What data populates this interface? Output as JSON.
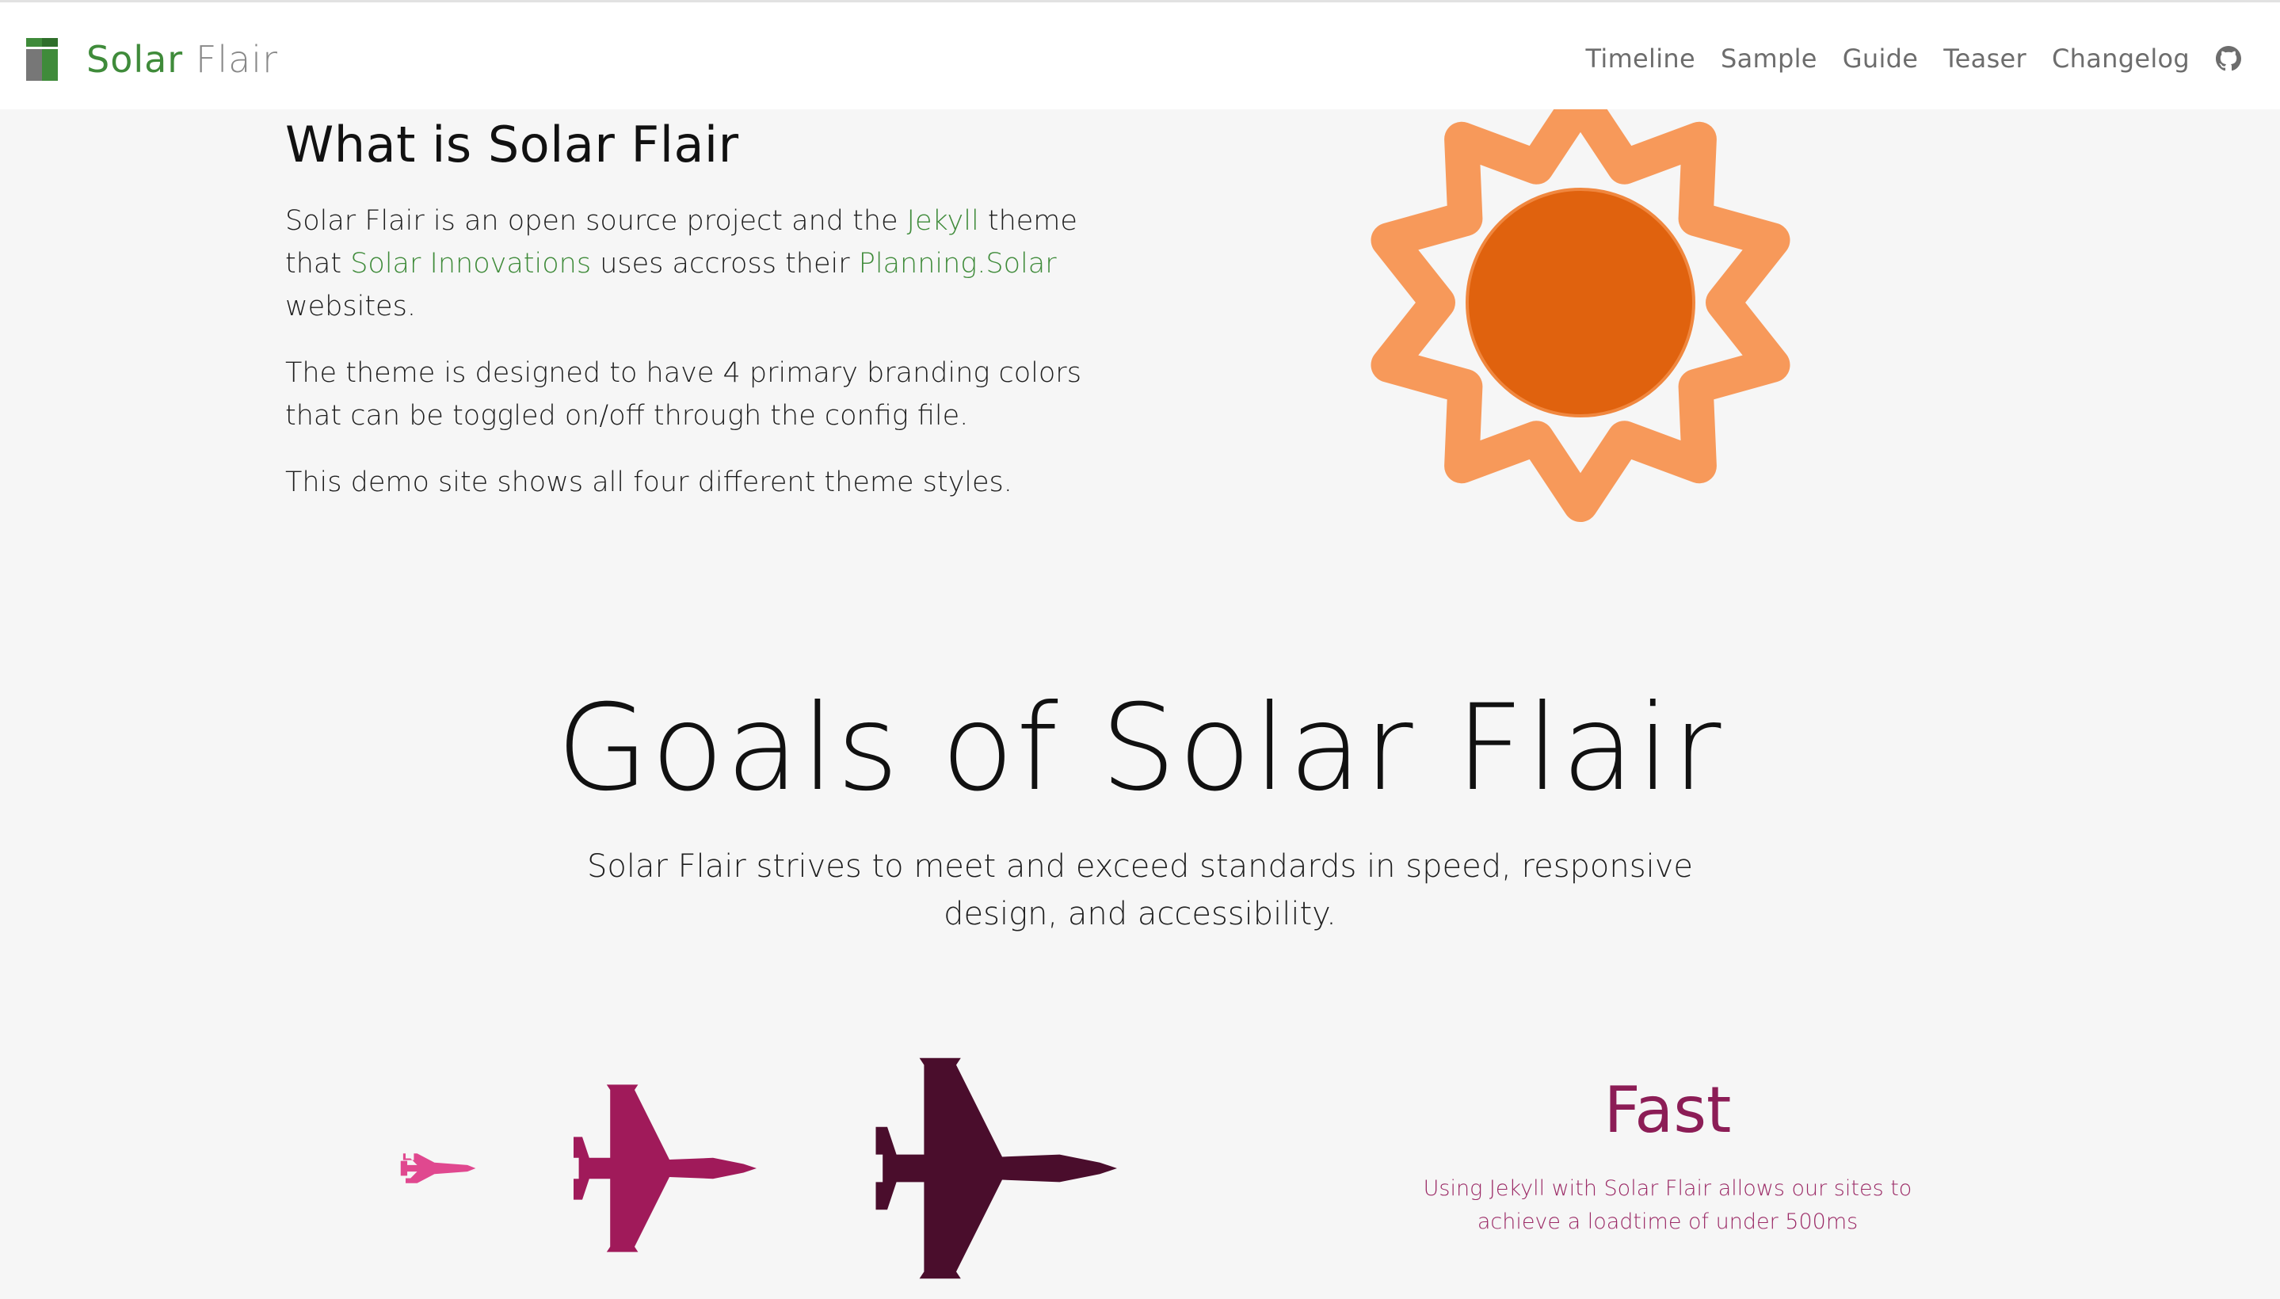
{
  "nav": {
    "brand": {
      "solar": "Solar",
      "flair": "Flair"
    },
    "links": [
      "Timeline",
      "Sample",
      "Guide",
      "Teaser",
      "Changelog"
    ],
    "github_icon": "github-icon"
  },
  "about": {
    "title": "What is Solar Flair",
    "p1": {
      "t1": "Solar Flair is an open source project and the ",
      "link_jekyll": "Jekyll",
      "t2": " theme that ",
      "link_solar_innovations": "Solar Innovations",
      "t3": " uses accross their ",
      "link_planning": "Planning.Solar",
      "t4": " websites."
    },
    "p2": "The theme is designed to have 4 primary branding colors that can be toggled on/off through the config file.",
    "p3": "This demo site shows all four different theme styles.",
    "sun_icon": "sun-icon"
  },
  "goals": {
    "title": "Goals of Solar Flair",
    "subtitle": "Solar Flair strives to meet and exceed standards in speed, responsive design, and accessibility."
  },
  "fast": {
    "title": "Fast",
    "text": "Using Jekyll with Solar Flair allows our sites to achieve a loadtime of under 500ms",
    "icons": [
      "jet-small-icon",
      "jet-medium-icon",
      "jet-large-icon"
    ]
  },
  "colors": {
    "brand_green": "#3f8b3a",
    "sun_ray": "#f7995a",
    "sun_core": "#e0620e",
    "jet_small": "#e0488f",
    "jet_medium": "#a01a5a",
    "jet_large": "#4a0d2c",
    "fast": "#8c1d56"
  }
}
